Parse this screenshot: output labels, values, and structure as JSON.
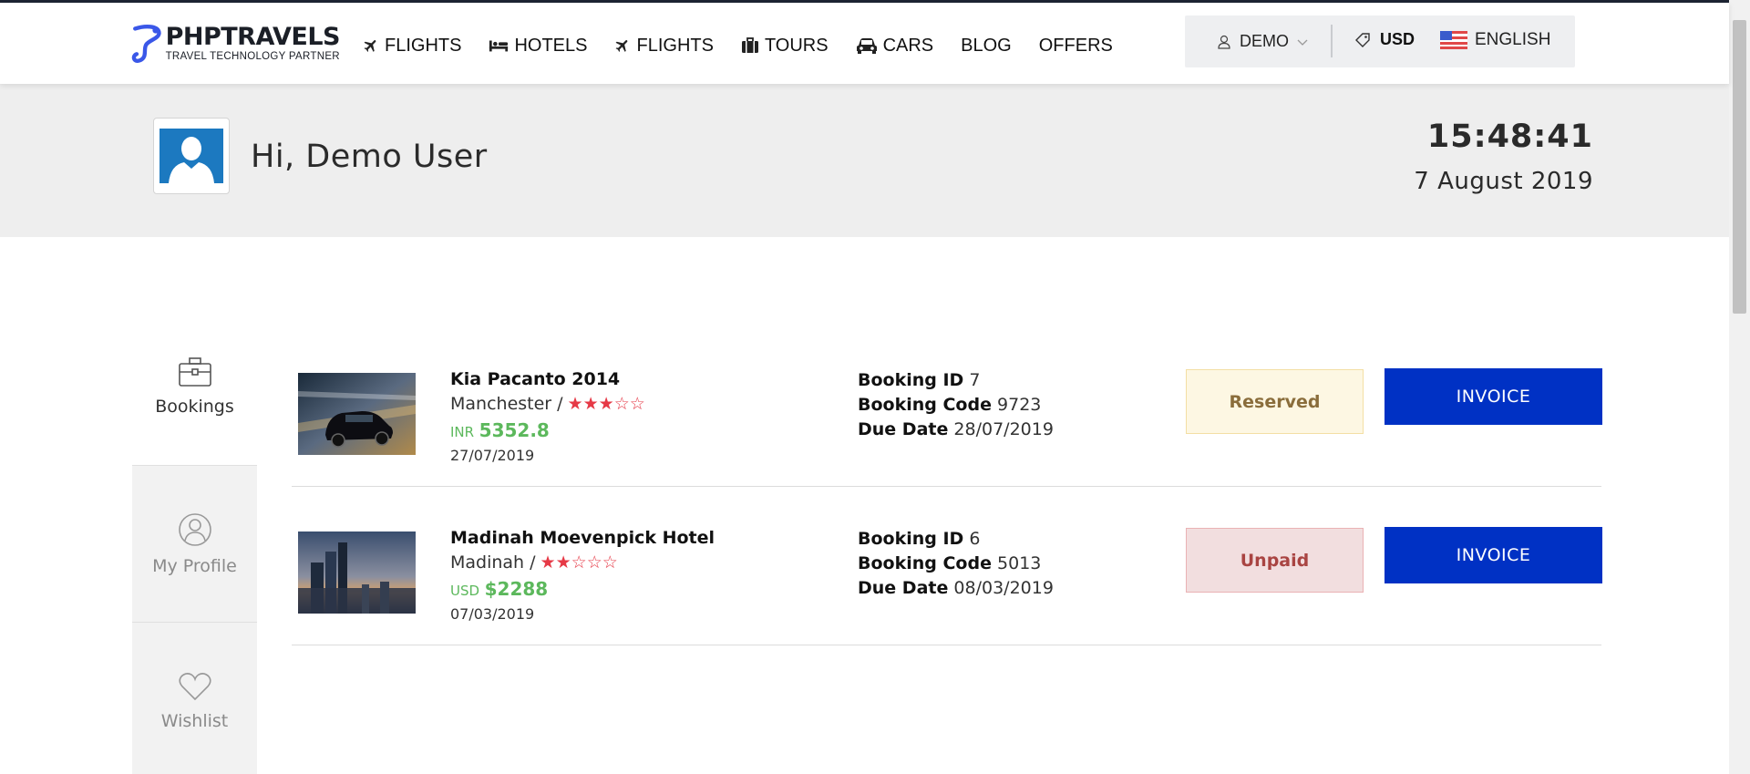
{
  "brand": {
    "name": "PHPTRAVELS",
    "tagline": "TRAVEL TECHNOLOGY PARTNER",
    "accent": "#3a57e8"
  },
  "nav": {
    "items": [
      {
        "label": "FLIGHTS",
        "icon": "plane-icon"
      },
      {
        "label": "HOTELS",
        "icon": "bed-icon"
      },
      {
        "label": "FLIGHTS",
        "icon": "plane-icon"
      },
      {
        "label": "TOURS",
        "icon": "suitcase-icon"
      },
      {
        "label": "CARS",
        "icon": "car-icon"
      },
      {
        "label": "BLOG",
        "icon": ""
      },
      {
        "label": "OFFERS",
        "icon": ""
      }
    ]
  },
  "header": {
    "user_label": "DEMO",
    "currency": "USD",
    "language": "ENGLISH"
  },
  "banner": {
    "greeting": "Hi, Demo User",
    "time": "15:48:41",
    "date": "7 August 2019"
  },
  "sidebar": {
    "items": [
      {
        "label": "Bookings",
        "icon": "briefcase-icon",
        "active": true
      },
      {
        "label": "My Profile",
        "icon": "user-circle-icon",
        "active": false
      },
      {
        "label": "Wishlist",
        "icon": "heart-icon",
        "active": false
      }
    ]
  },
  "bookings": [
    {
      "title": "Kia Pacanto 2014",
      "location": "Manchester /",
      "stars": 3,
      "max_stars": 5,
      "currency": "INR",
      "amount": "5352.8",
      "date": "27/07/2019",
      "booking_id_label": "Booking ID",
      "booking_id": "7",
      "booking_code_label": "Booking Code",
      "booking_code": "9723",
      "due_date_label": "Due Date",
      "due_date": "28/07/2019",
      "status": "Reserved",
      "invoice_label": "INVOICE"
    },
    {
      "title": "Madinah Moevenpick Hotel",
      "location": "Madinah /",
      "stars": 2,
      "max_stars": 5,
      "currency": "USD",
      "amount": "$2288",
      "date": "07/03/2019",
      "booking_id_label": "Booking ID",
      "booking_id": "6",
      "booking_code_label": "Booking Code",
      "booking_code": "5013",
      "due_date_label": "Due Date",
      "due_date": "08/03/2019",
      "status": "Unpaid",
      "invoice_label": "INVOICE"
    }
  ],
  "colors": {
    "invoice_button": "#0031c4",
    "reserved_bg": "#fdf7e3",
    "unpaid_bg": "#f2dedf",
    "price_green": "#5cb85c",
    "star_red": "#e63946"
  }
}
